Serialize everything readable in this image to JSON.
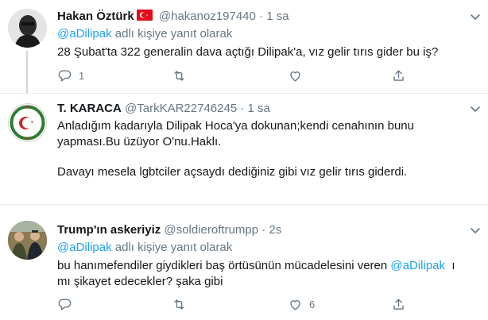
{
  "tweets": [
    {
      "name": "Hakan Öztürk",
      "handle": "@hakanoz197440",
      "time": "1 sa",
      "reply_mention": "@aDilipak",
      "reply_suffix": " adlı kişiye yanıt olarak",
      "text": "28 Şubat'ta 322 generalin dava açtığı Dilipak'a, vız gelir tırıs gider bu iş?",
      "reply_count": "1",
      "retweet_count": "",
      "like_count": ""
    },
    {
      "name": "T. KARACA",
      "handle": "@TarkKAR22746245",
      "time": "1 sa",
      "line1": "Anladığım kadarıyla Dilipak Hoca'ya dokunan;kendi cenahının bunu",
      "line2": "yapması.Bu üzüyor O'nu.Haklı.",
      "line3": "Davayı mesela lgbtciler açsaydı dediğiniz gibi vız gelir tırıs giderdi.",
      "reply_count": "",
      "retweet_count": "",
      "like_count": ""
    },
    {
      "name": "Trump'ın askeriyiz",
      "handle": "@soldieroftrumpp",
      "time": "2s",
      "reply_mention": "@aDilipak",
      "reply_suffix": " adlı kişiye yanıt olarak",
      "line1_prefix": "bu hanımefendiler giydikleri baş örtüsünün mücadelesini veren ",
      "line1_mention": "@aDilipak",
      "line1_suffix": "  ı",
      "line2": "mı şikayet edecekler? şaka gibi",
      "reply_count": "",
      "retweet_count": "",
      "like_count": "6"
    }
  ],
  "dot": "·",
  "colors": {
    "link": "#1da1f2",
    "muted": "#657786",
    "text": "#14171a",
    "divider": "#e6ecf0",
    "flag": "#e30a17"
  },
  "icons": [
    "reply-icon",
    "retweet-icon",
    "like-icon",
    "share-icon",
    "chevron-down-icon",
    "turkey-flag-icon"
  ]
}
